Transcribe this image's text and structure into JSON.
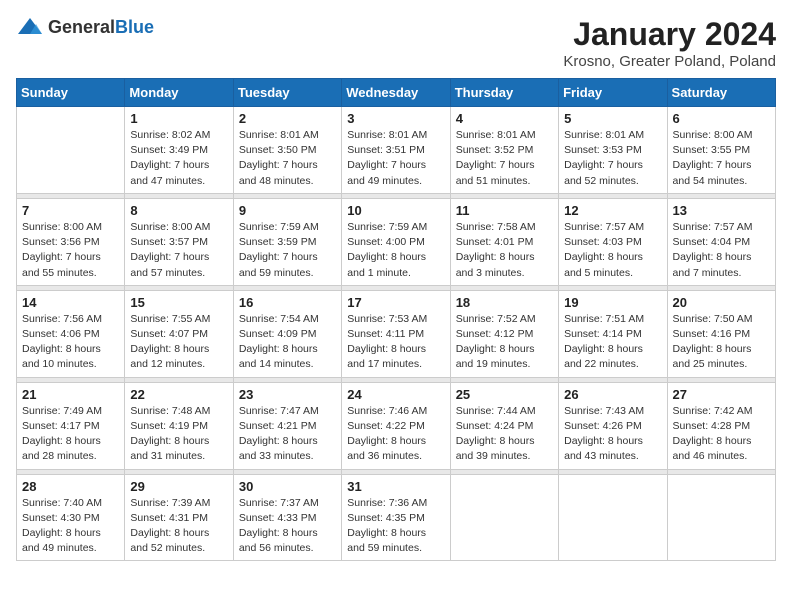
{
  "header": {
    "logo_general": "General",
    "logo_blue": "Blue",
    "month": "January 2024",
    "location": "Krosno, Greater Poland, Poland"
  },
  "days_of_week": [
    "Sunday",
    "Monday",
    "Tuesday",
    "Wednesday",
    "Thursday",
    "Friday",
    "Saturday"
  ],
  "weeks": [
    [
      {
        "day": "",
        "info": ""
      },
      {
        "day": "1",
        "info": "Sunrise: 8:02 AM\nSunset: 3:49 PM\nDaylight: 7 hours\nand 47 minutes."
      },
      {
        "day": "2",
        "info": "Sunrise: 8:01 AM\nSunset: 3:50 PM\nDaylight: 7 hours\nand 48 minutes."
      },
      {
        "day": "3",
        "info": "Sunrise: 8:01 AM\nSunset: 3:51 PM\nDaylight: 7 hours\nand 49 minutes."
      },
      {
        "day": "4",
        "info": "Sunrise: 8:01 AM\nSunset: 3:52 PM\nDaylight: 7 hours\nand 51 minutes."
      },
      {
        "day": "5",
        "info": "Sunrise: 8:01 AM\nSunset: 3:53 PM\nDaylight: 7 hours\nand 52 minutes."
      },
      {
        "day": "6",
        "info": "Sunrise: 8:00 AM\nSunset: 3:55 PM\nDaylight: 7 hours\nand 54 minutes."
      }
    ],
    [
      {
        "day": "7",
        "info": "Sunrise: 8:00 AM\nSunset: 3:56 PM\nDaylight: 7 hours\nand 55 minutes."
      },
      {
        "day": "8",
        "info": "Sunrise: 8:00 AM\nSunset: 3:57 PM\nDaylight: 7 hours\nand 57 minutes."
      },
      {
        "day": "9",
        "info": "Sunrise: 7:59 AM\nSunset: 3:59 PM\nDaylight: 7 hours\nand 59 minutes."
      },
      {
        "day": "10",
        "info": "Sunrise: 7:59 AM\nSunset: 4:00 PM\nDaylight: 8 hours\nand 1 minute."
      },
      {
        "day": "11",
        "info": "Sunrise: 7:58 AM\nSunset: 4:01 PM\nDaylight: 8 hours\nand 3 minutes."
      },
      {
        "day": "12",
        "info": "Sunrise: 7:57 AM\nSunset: 4:03 PM\nDaylight: 8 hours\nand 5 minutes."
      },
      {
        "day": "13",
        "info": "Sunrise: 7:57 AM\nSunset: 4:04 PM\nDaylight: 8 hours\nand 7 minutes."
      }
    ],
    [
      {
        "day": "14",
        "info": "Sunrise: 7:56 AM\nSunset: 4:06 PM\nDaylight: 8 hours\nand 10 minutes."
      },
      {
        "day": "15",
        "info": "Sunrise: 7:55 AM\nSunset: 4:07 PM\nDaylight: 8 hours\nand 12 minutes."
      },
      {
        "day": "16",
        "info": "Sunrise: 7:54 AM\nSunset: 4:09 PM\nDaylight: 8 hours\nand 14 minutes."
      },
      {
        "day": "17",
        "info": "Sunrise: 7:53 AM\nSunset: 4:11 PM\nDaylight: 8 hours\nand 17 minutes."
      },
      {
        "day": "18",
        "info": "Sunrise: 7:52 AM\nSunset: 4:12 PM\nDaylight: 8 hours\nand 19 minutes."
      },
      {
        "day": "19",
        "info": "Sunrise: 7:51 AM\nSunset: 4:14 PM\nDaylight: 8 hours\nand 22 minutes."
      },
      {
        "day": "20",
        "info": "Sunrise: 7:50 AM\nSunset: 4:16 PM\nDaylight: 8 hours\nand 25 minutes."
      }
    ],
    [
      {
        "day": "21",
        "info": "Sunrise: 7:49 AM\nSunset: 4:17 PM\nDaylight: 8 hours\nand 28 minutes."
      },
      {
        "day": "22",
        "info": "Sunrise: 7:48 AM\nSunset: 4:19 PM\nDaylight: 8 hours\nand 31 minutes."
      },
      {
        "day": "23",
        "info": "Sunrise: 7:47 AM\nSunset: 4:21 PM\nDaylight: 8 hours\nand 33 minutes."
      },
      {
        "day": "24",
        "info": "Sunrise: 7:46 AM\nSunset: 4:22 PM\nDaylight: 8 hours\nand 36 minutes."
      },
      {
        "day": "25",
        "info": "Sunrise: 7:44 AM\nSunset: 4:24 PM\nDaylight: 8 hours\nand 39 minutes."
      },
      {
        "day": "26",
        "info": "Sunrise: 7:43 AM\nSunset: 4:26 PM\nDaylight: 8 hours\nand 43 minutes."
      },
      {
        "day": "27",
        "info": "Sunrise: 7:42 AM\nSunset: 4:28 PM\nDaylight: 8 hours\nand 46 minutes."
      }
    ],
    [
      {
        "day": "28",
        "info": "Sunrise: 7:40 AM\nSunset: 4:30 PM\nDaylight: 8 hours\nand 49 minutes."
      },
      {
        "day": "29",
        "info": "Sunrise: 7:39 AM\nSunset: 4:31 PM\nDaylight: 8 hours\nand 52 minutes."
      },
      {
        "day": "30",
        "info": "Sunrise: 7:37 AM\nSunset: 4:33 PM\nDaylight: 8 hours\nand 56 minutes."
      },
      {
        "day": "31",
        "info": "Sunrise: 7:36 AM\nSunset: 4:35 PM\nDaylight: 8 hours\nand 59 minutes."
      },
      {
        "day": "",
        "info": ""
      },
      {
        "day": "",
        "info": ""
      },
      {
        "day": "",
        "info": ""
      }
    ]
  ]
}
